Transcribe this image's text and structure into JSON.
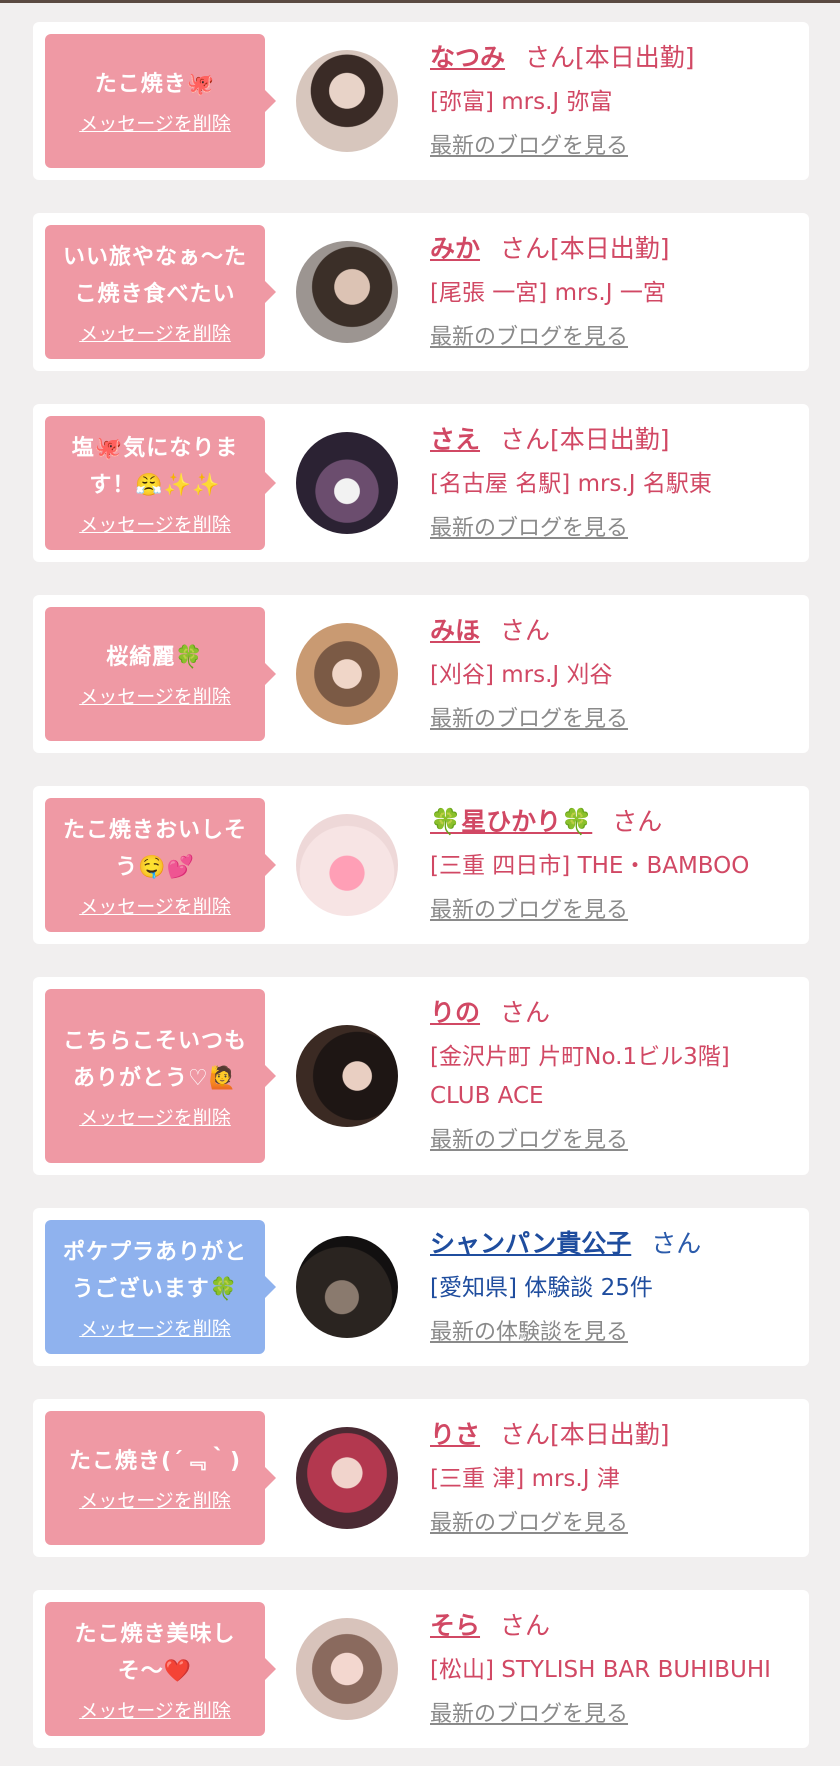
{
  "cards": [
    {
      "message": "たこ焼き🐙",
      "delete_label": "メッセージを削除",
      "name": "なつみ",
      "san": "さん[本日出勤]",
      "shop": "[弥富] mrs.J 弥富",
      "blog_link": "最新のブログを見る"
    },
    {
      "message": "いい旅やなぁ〜たこ焼き食べたい",
      "delete_label": "メッセージを削除",
      "name": "みか",
      "san": "さん[本日出勤]",
      "shop": "[尾張 一宮] mrs.J 一宮",
      "blog_link": "最新のブログを見る"
    },
    {
      "message": "塩🐙気になります！😤✨✨",
      "delete_label": "メッセージを削除",
      "name": "さえ",
      "san": "さん[本日出勤]",
      "shop": "[名古屋 名駅] mrs.J 名駅東",
      "blog_link": "最新のブログを見る"
    },
    {
      "message": "桜綺麗🍀",
      "delete_label": "メッセージを削除",
      "name": "みほ",
      "san": "さん",
      "shop": "[刈谷] mrs.J 刈谷",
      "blog_link": "最新のブログを見る"
    },
    {
      "message": "たこ焼きおいしそう🤤💕",
      "delete_label": "メッセージを削除",
      "name": "🍀星ひかり🍀",
      "san": "さん",
      "shop": "[三重 四日市] THE・BAMBOO",
      "blog_link": "最新のブログを見る"
    },
    {
      "message": "こちらこそいつもありがとう♡🙋",
      "delete_label": "メッセージを削除",
      "name": "りの",
      "san": "さん",
      "shop": "[金沢片町 片町No.1ビル3階] CLUB ACE",
      "blog_link": "最新のブログを見る"
    },
    {
      "message": "ポケプラありがとうございます🍀",
      "delete_label": "メッセージを削除",
      "name": "シャンパン貴公子",
      "san": "さん",
      "shop": "[愛知県] 体験談 25件",
      "blog_link": "最新の体験談を見る"
    },
    {
      "message": "たこ焼き(´﹃｀)",
      "delete_label": "メッセージを削除",
      "name": "りさ",
      "san": "さん[本日出勤]",
      "shop": "[三重 津] mrs.J 津",
      "blog_link": "最新のブログを見る"
    },
    {
      "message": "たこ焼き美味しそ〜❤️",
      "delete_label": "メッセージを削除",
      "name": "そら",
      "san": "さん",
      "shop": "[松山] STYLISH BAR BUHIBUHI",
      "blog_link": "最新のブログを見る"
    }
  ],
  "colors": {
    "background": "#f1efef",
    "bubble_pink": "#ef99a4",
    "bubble_blue": "#8fb2ee",
    "name_pink": "#d14864",
    "name_blue": "#1f4d9e",
    "link_gray": "#8a8a8a"
  }
}
